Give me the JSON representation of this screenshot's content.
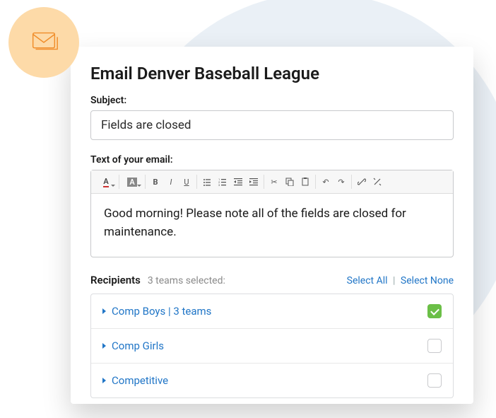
{
  "title": "Email Denver Baseball League",
  "subject": {
    "label": "Subject:",
    "value": "Fields are closed"
  },
  "body": {
    "label": "Text of your email:",
    "text": "Good morning! Please note all of the fields are closed for maintenance."
  },
  "recipients": {
    "label": "Recipients",
    "summary": "3 teams selected:",
    "select_all": "Select All",
    "select_none": "Select None",
    "groups": [
      {
        "label": "Comp Boys | 3 teams",
        "checked": true
      },
      {
        "label": "Comp Girls",
        "checked": false
      },
      {
        "label": "Competitive",
        "checked": false
      }
    ]
  }
}
